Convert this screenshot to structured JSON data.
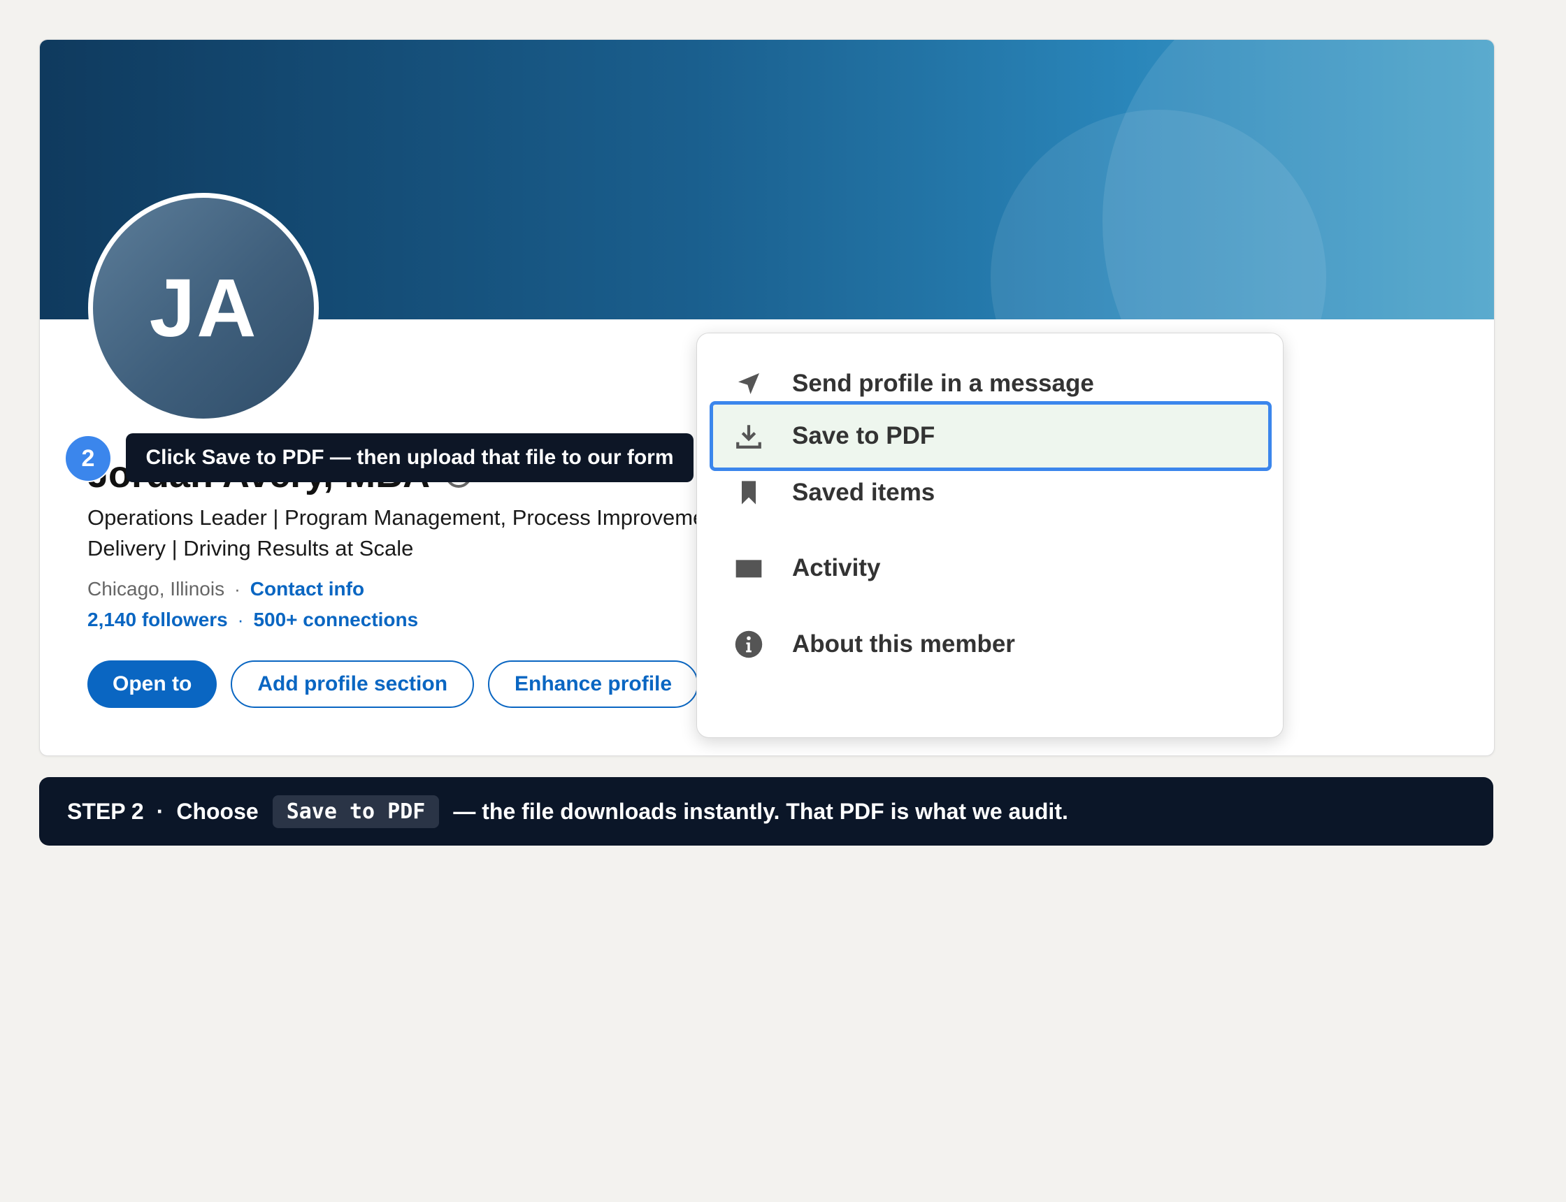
{
  "profile": {
    "initials": "JA",
    "name": "Jordan Avery, MBA",
    "headline": "Operations Leader | Program Management, Process Improvement & Delivery | Driving Results at Scale",
    "location": "Chicago, Illinois",
    "contact_info": "Contact info",
    "separator": "·",
    "followers": "2,140 followers",
    "connections": "500+ connections",
    "actions": {
      "open_to": "Open to",
      "add_section": "Add profile section",
      "enhance": "Enhance profile"
    }
  },
  "menu": {
    "items": [
      {
        "label": "Send profile in a message",
        "icon": "send-icon"
      },
      {
        "label": "Save to PDF",
        "icon": "download-icon",
        "highlighted": true
      },
      {
        "label": "Saved items",
        "icon": "bookmark-icon"
      },
      {
        "label": "Activity",
        "icon": "activity-icon"
      },
      {
        "label": "About this member",
        "icon": "info-icon"
      }
    ]
  },
  "overlay": {
    "step_number": "2",
    "tooltip": "Click Save to PDF — then upload that file to our form"
  },
  "step_bar": {
    "step": "STEP 2",
    "dot": "·",
    "choose": "Choose",
    "code": "Save to PDF",
    "rest": "— the file downloads instantly. That PDF is what we audit."
  },
  "colors": {
    "brand_blue": "#0a66c2",
    "highlight_border": "#3b86ec",
    "highlight_bg": "#eef6ee",
    "dark_bar": "#0b1628"
  }
}
